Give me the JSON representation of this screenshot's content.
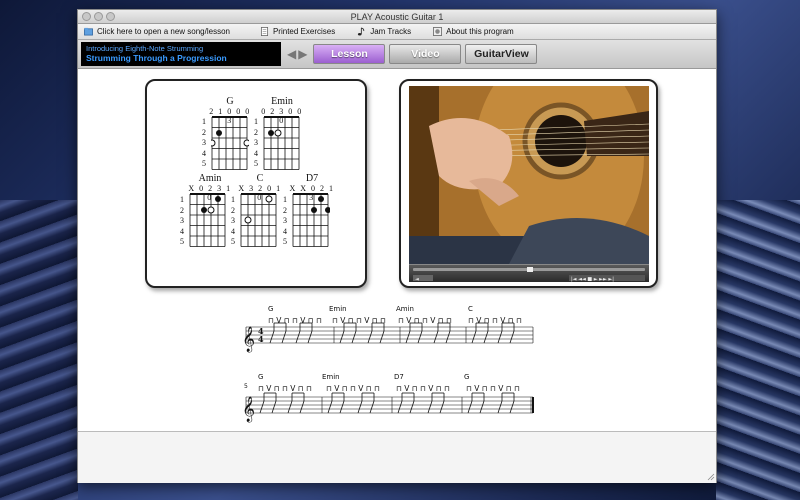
{
  "window": {
    "title": "PLAY Acoustic Guitar 1"
  },
  "menu": {
    "open_label": "Click here to open a new song/lesson",
    "printed_label": "Printed Exercises",
    "jam_label": "Jam Tracks",
    "about_label": "About this program"
  },
  "lesson": {
    "subtitle": "Introducing Eighth-Note Strumming",
    "title": "Strumming Through a Progression"
  },
  "tabs": {
    "lesson": "Lesson",
    "video": "Video",
    "guitarview": "GuitarView"
  },
  "chords": [
    {
      "name": "G",
      "fingering": "2 1 0 0 0 3"
    },
    {
      "name": "Emin",
      "fingering": "0 2 3 0 0 0"
    },
    {
      "name": "Amin",
      "fingering": "X 0 2 3 1 0"
    },
    {
      "name": "C",
      "fingering": "X 3 2 0 1 0"
    },
    {
      "name": "D7",
      "fingering": "X X 0 2 1 3"
    }
  ],
  "fret_numbers": [
    "1",
    "2",
    "3",
    "4",
    "5"
  ],
  "staff1": {
    "measure_number": "",
    "chords": [
      "G",
      "Emin",
      "Amin",
      "C"
    ],
    "time_top": "4",
    "time_bottom": "4"
  },
  "staff2": {
    "measure_number": "5",
    "chords": [
      "G",
      "Emin",
      "D7",
      "G"
    ]
  },
  "colors": {
    "lesson_tab": "#9b5fd0",
    "lesson_text": "#3a9bff"
  }
}
